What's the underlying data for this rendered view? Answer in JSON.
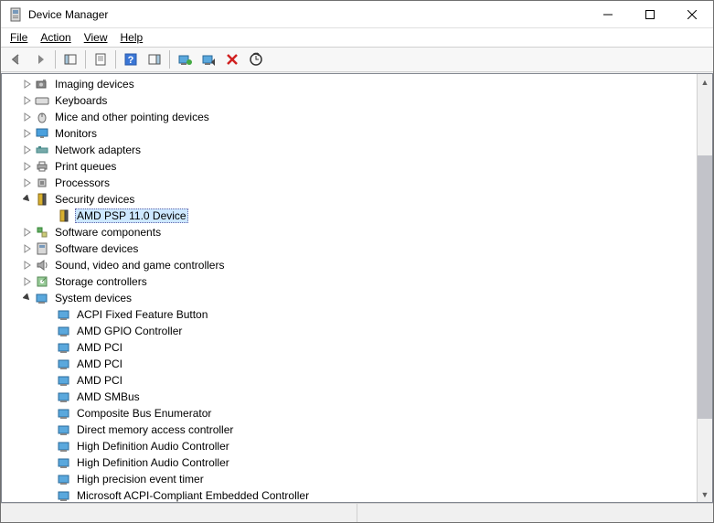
{
  "window": {
    "title": "Device Manager"
  },
  "menu": {
    "file": "File",
    "action": "Action",
    "view": "View",
    "help": "Help"
  },
  "tree": {
    "categories": [
      {
        "label": "Imaging devices",
        "icon": "camera",
        "expanded": false,
        "hasChildren": true
      },
      {
        "label": "Keyboards",
        "icon": "keyboard",
        "expanded": false,
        "hasChildren": true
      },
      {
        "label": "Mice and other pointing devices",
        "icon": "mouse",
        "expanded": false,
        "hasChildren": true
      },
      {
        "label": "Monitors",
        "icon": "monitor",
        "expanded": false,
        "hasChildren": true
      },
      {
        "label": "Network adapters",
        "icon": "network",
        "expanded": false,
        "hasChildren": true
      },
      {
        "label": "Print queues",
        "icon": "printer",
        "expanded": false,
        "hasChildren": true
      },
      {
        "label": "Processors",
        "icon": "cpu",
        "expanded": false,
        "hasChildren": true
      },
      {
        "label": "Security devices",
        "icon": "security",
        "expanded": true,
        "hasChildren": true,
        "children": [
          {
            "label": "AMD PSP 11.0 Device",
            "icon": "security",
            "selected": true
          }
        ]
      },
      {
        "label": "Software components",
        "icon": "component",
        "expanded": false,
        "hasChildren": true
      },
      {
        "label": "Software devices",
        "icon": "softdev",
        "expanded": false,
        "hasChildren": true
      },
      {
        "label": "Sound, video and game controllers",
        "icon": "sound",
        "expanded": false,
        "hasChildren": true
      },
      {
        "label": "Storage controllers",
        "icon": "storage",
        "expanded": false,
        "hasChildren": true
      },
      {
        "label": "System devices",
        "icon": "system",
        "expanded": true,
        "hasChildren": true,
        "children": [
          {
            "label": "ACPI Fixed Feature Button",
            "icon": "system"
          },
          {
            "label": "AMD GPIO Controller",
            "icon": "system"
          },
          {
            "label": "AMD PCI",
            "icon": "system"
          },
          {
            "label": "AMD PCI",
            "icon": "system"
          },
          {
            "label": "AMD PCI",
            "icon": "system"
          },
          {
            "label": "AMD SMBus",
            "icon": "system"
          },
          {
            "label": "Composite Bus Enumerator",
            "icon": "system"
          },
          {
            "label": "Direct memory access controller",
            "icon": "system"
          },
          {
            "label": "High Definition Audio Controller",
            "icon": "system"
          },
          {
            "label": "High Definition Audio Controller",
            "icon": "system"
          },
          {
            "label": "High precision event timer",
            "icon": "system"
          },
          {
            "label": "Microsoft ACPI-Compliant Embedded Controller",
            "icon": "system"
          }
        ]
      }
    ]
  }
}
